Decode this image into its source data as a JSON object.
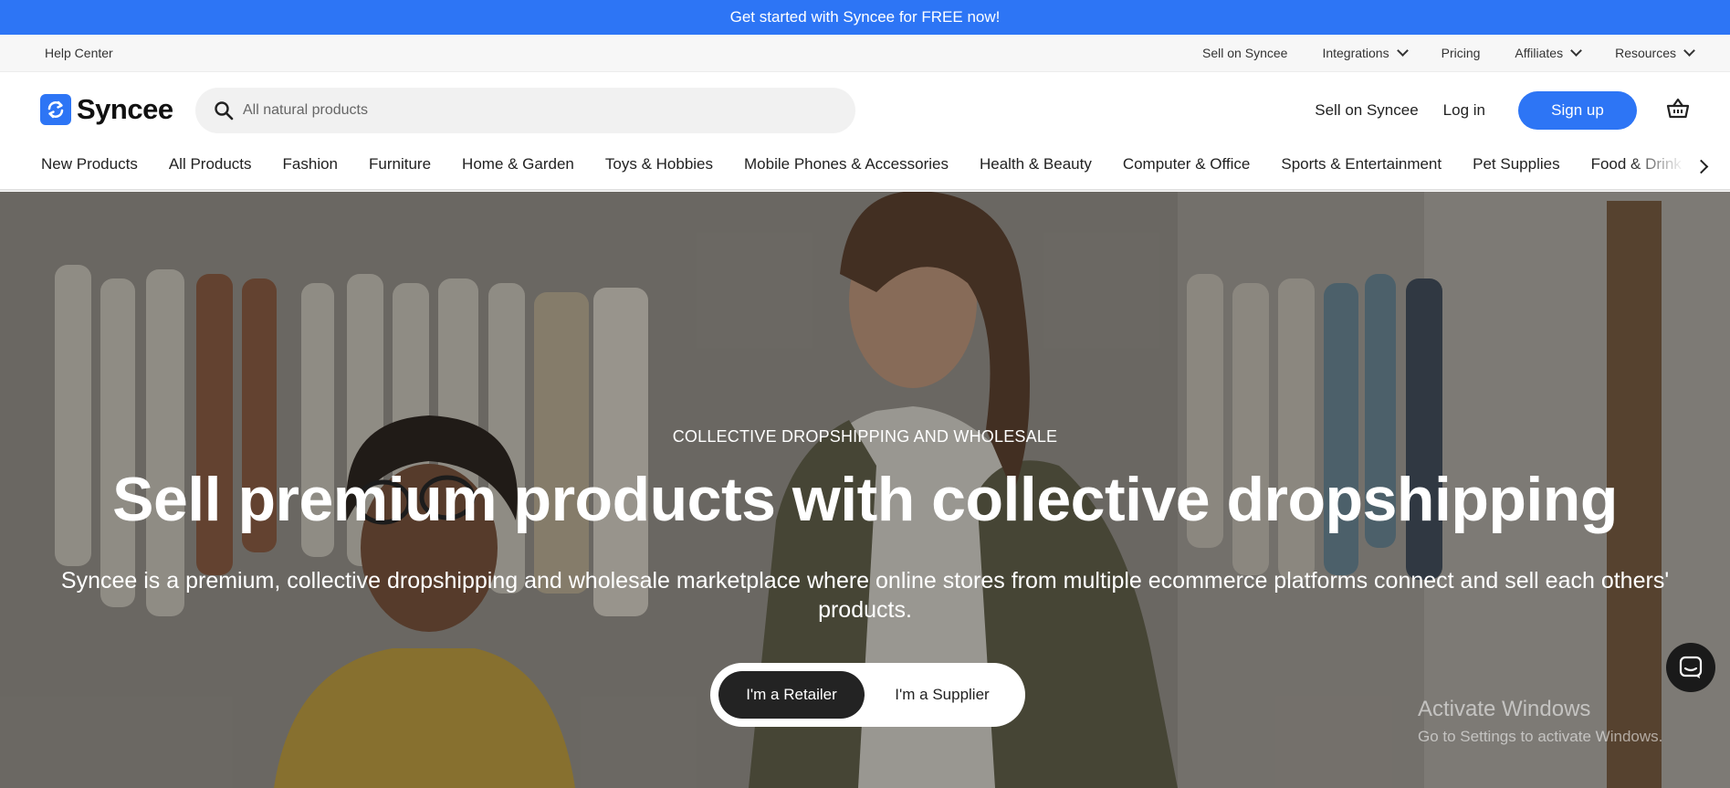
{
  "promo": {
    "text": "Get started with Syncee for FREE now!"
  },
  "utility": {
    "help": "Help Center",
    "links": [
      {
        "label": "Sell on Syncee",
        "dropdown": false
      },
      {
        "label": "Integrations",
        "dropdown": true
      },
      {
        "label": "Pricing",
        "dropdown": false
      },
      {
        "label": "Affiliates",
        "dropdown": true
      },
      {
        "label": "Resources",
        "dropdown": true
      }
    ]
  },
  "header": {
    "logo_text": "Syncee",
    "search_placeholder": "All natural products",
    "sell_label": "Sell on Syncee",
    "login_label": "Log in",
    "signup_label": "Sign up"
  },
  "categories": [
    "New Products",
    "All Products",
    "Fashion",
    "Furniture",
    "Home & Garden",
    "Toys & Hobbies",
    "Mobile Phones & Accessories",
    "Health & Beauty",
    "Computer & Office",
    "Sports & Entertainment",
    "Pet Supplies",
    "Food & Drink"
  ],
  "hero": {
    "eyebrow": "COLLECTIVE DROPSHIPPING AND WHOLESALE",
    "headline": "Sell premium products with collective dropshipping",
    "subline": "Syncee is a premium, collective dropshipping and wholesale marketplace where online stores from multiple ecommerce platforms connect and sell each others' products.",
    "retailer_label": "I'm a Retailer",
    "supplier_label": "I'm a Supplier"
  },
  "watermark": {
    "line1": "Activate Windows",
    "line2": "Go to Settings to activate Windows."
  },
  "colors": {
    "brand": "#2d75f5",
    "dark": "#232323"
  }
}
